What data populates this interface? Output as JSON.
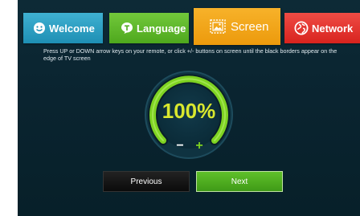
{
  "tabs": [
    {
      "label": "Welcome",
      "icon": "smiley-icon"
    },
    {
      "label": "Language",
      "icon": "t-bubble-icon"
    },
    {
      "label": "Screen",
      "icon": "screen-picture-icon"
    },
    {
      "label": "Network",
      "icon": "globe-icon"
    }
  ],
  "instruction": "Press UP or DOWN arrow keys on your remote, or click +/- buttons on screen until the black borders appear on the edge of TV screen",
  "zoom": {
    "value": "100%",
    "minus": "−",
    "plus": "+"
  },
  "buttons": {
    "previous": "Previous",
    "next": "Next"
  },
  "colors": {
    "welcome": "#2a9fc4",
    "language": "#5db62a",
    "screen": "#f2a61a",
    "network": "#e2332d",
    "dial_green": "#7ed321",
    "percent_text": "#d9e82e"
  }
}
